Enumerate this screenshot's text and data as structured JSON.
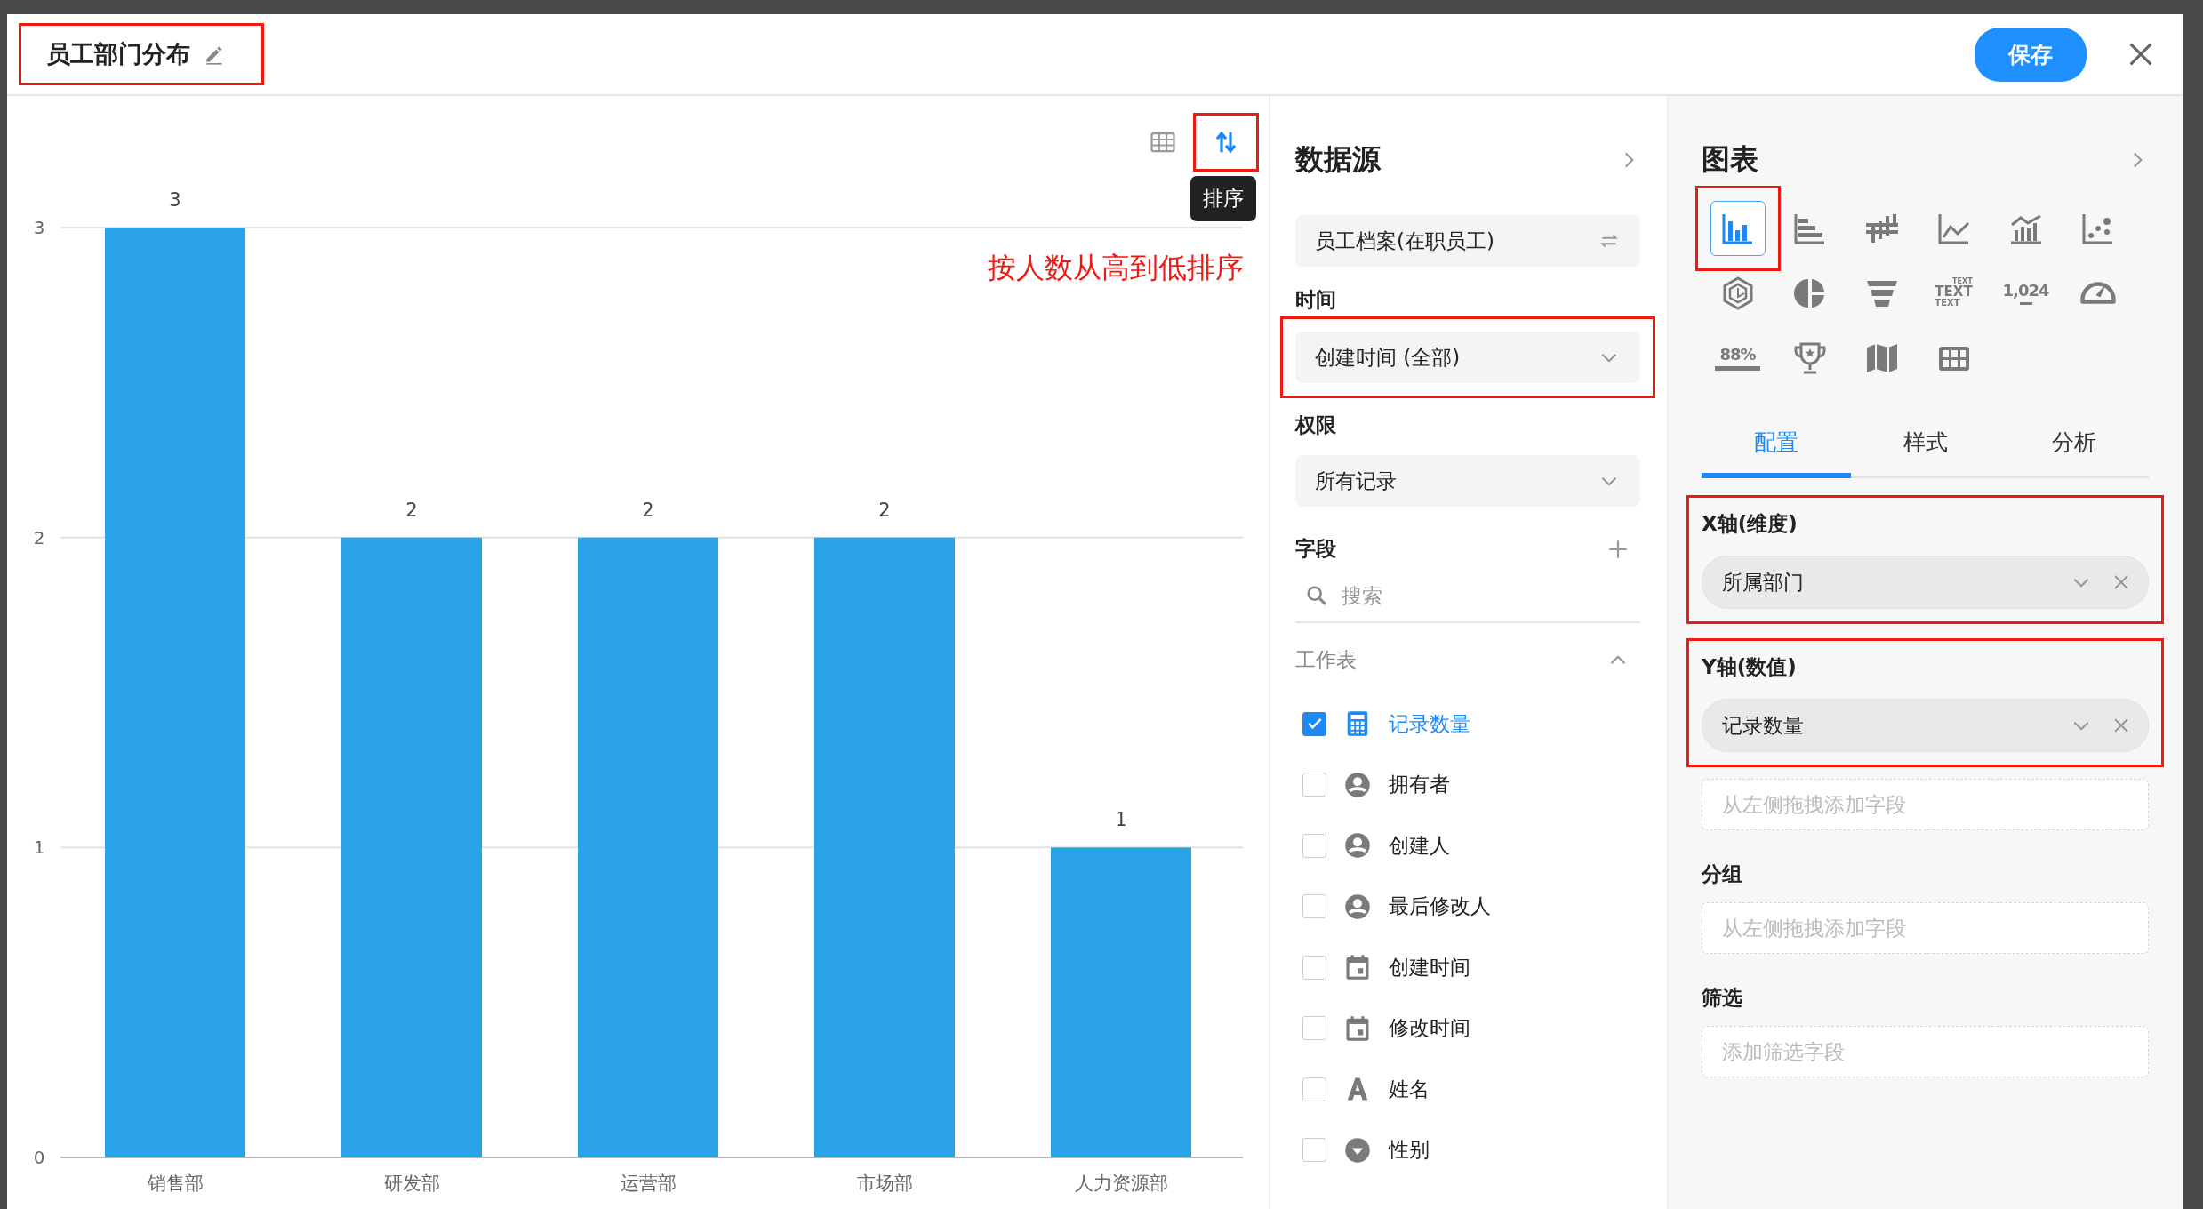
{
  "dialog": {
    "title": "员工部门分布",
    "title_highlighted": true,
    "save_button": "保存"
  },
  "chart_toolbar": {
    "sort_highlighted": true,
    "tooltip": "排序",
    "annotation": "按人数从高到低排序"
  },
  "chart": {
    "chart_data": {
      "type": "bar",
      "categories": [
        "销售部",
        "研发部",
        "运营部",
        "市场部",
        "人力资源部"
      ],
      "values": [
        3,
        2,
        2,
        2,
        1
      ],
      "yticks": [
        0,
        1,
        2,
        3
      ],
      "ylim": [
        0,
        3
      ],
      "data_labels": true
    }
  },
  "data_source": {
    "heading": "数据源",
    "source": "员工档案(在职员工)",
    "time_label": "时间",
    "time_value": "创建时间 (全部)",
    "time_highlighted": true,
    "permission_label": "权限",
    "permission_value": "所有记录",
    "fields_label": "字段",
    "search": {
      "placeholder": "搜索"
    },
    "group_label": "工作表",
    "fields": [
      {
        "kind": "count",
        "label": "记录数量",
        "checked": true
      },
      {
        "kind": "user",
        "label": "拥有者",
        "checked": false
      },
      {
        "kind": "user",
        "label": "创建人",
        "checked": false
      },
      {
        "kind": "user",
        "label": "最后修改人",
        "checked": false
      },
      {
        "kind": "date",
        "label": "创建时间",
        "checked": false
      },
      {
        "kind": "date",
        "label": "修改时间",
        "checked": false
      },
      {
        "kind": "text",
        "label": "姓名",
        "checked": false
      },
      {
        "kind": "option",
        "label": "性别",
        "checked": false
      }
    ]
  },
  "chart_config": {
    "heading": "图表",
    "chart_types": [
      {
        "kind": "bar",
        "selected": true,
        "highlighted": true
      },
      {
        "kind": "hbar",
        "selected": false
      },
      {
        "kind": "cross",
        "selected": false
      },
      {
        "kind": "line",
        "selected": false
      },
      {
        "kind": "combo",
        "selected": false
      },
      {
        "kind": "scatter",
        "selected": false
      },
      {
        "kind": "radar",
        "selected": false
      },
      {
        "kind": "pie",
        "selected": false
      },
      {
        "kind": "funnel",
        "selected": false
      },
      {
        "kind": "text",
        "selected": false,
        "labels": [
          "TEXT",
          "TEXT",
          "TEXT"
        ]
      },
      {
        "kind": "number",
        "selected": false,
        "label": "1,024"
      },
      {
        "kind": "gauge",
        "selected": false
      },
      {
        "kind": "progress",
        "selected": false,
        "label": "88%"
      },
      {
        "kind": "trophy",
        "selected": false
      },
      {
        "kind": "map",
        "selected": false
      },
      {
        "kind": "table",
        "selected": false
      }
    ],
    "tabs": [
      {
        "label": "配置",
        "selected": true
      },
      {
        "label": "样式",
        "selected": false
      },
      {
        "label": "分析",
        "selected": false
      }
    ],
    "x_axis": {
      "label": "X轴(维度)",
      "field": "所属部门",
      "highlighted": true
    },
    "y_axis": {
      "label": "Y轴(数值)",
      "field": "记录数量",
      "highlighted": true,
      "drop_placeholder": "从左侧拖拽添加字段"
    },
    "group": {
      "label": "分组",
      "drop_placeholder": "从左侧拖拽添加字段"
    },
    "filter": {
      "label": "筛选",
      "drop_placeholder": "添加筛选字段"
    }
  }
}
